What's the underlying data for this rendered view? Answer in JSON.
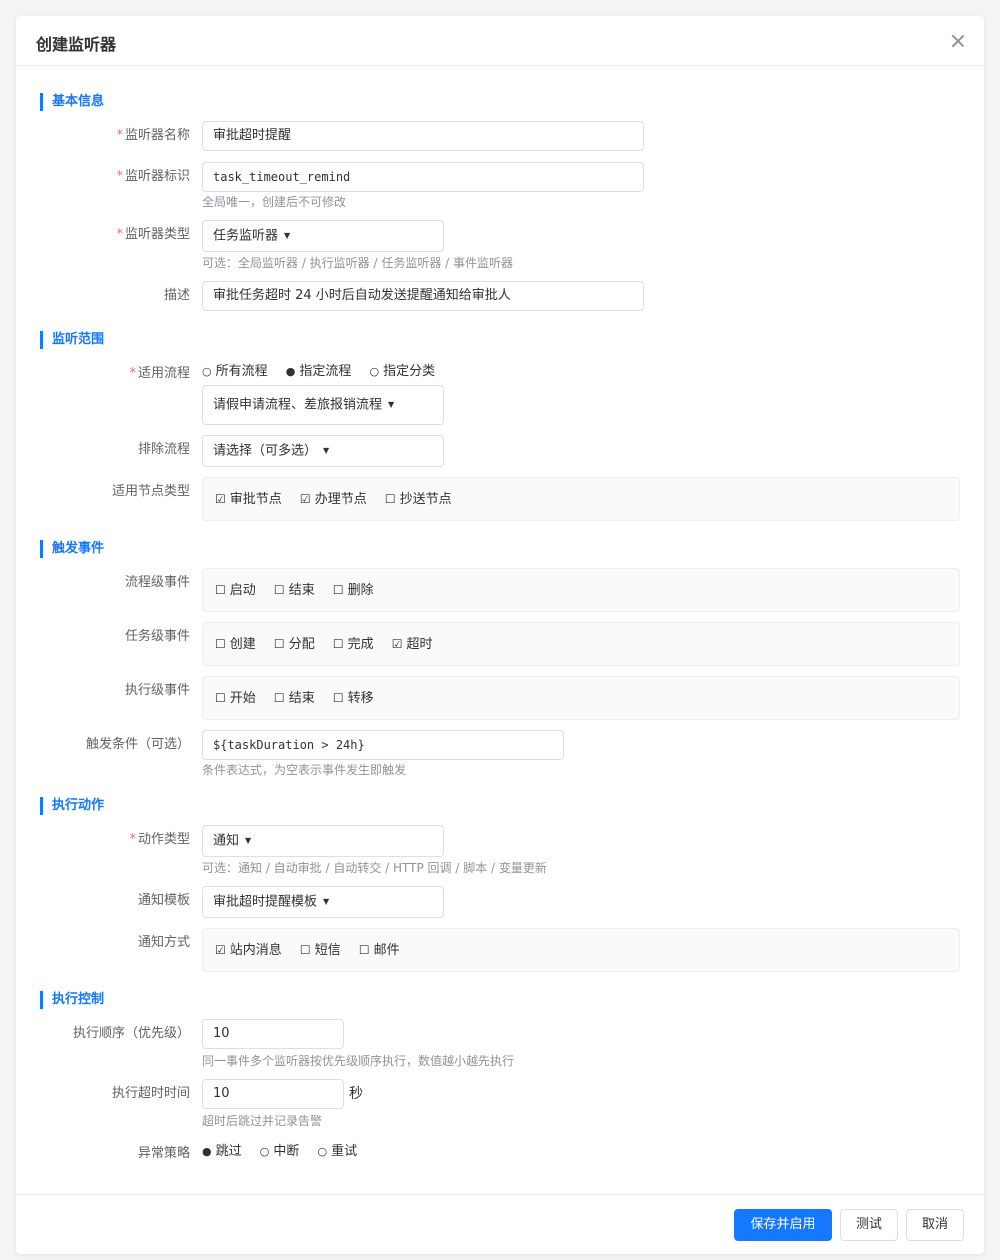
{
  "dialog": {
    "title": "创建监听器"
  },
  "sections": {
    "basic": "基本信息",
    "scope": "监听范围",
    "events": "触发事件",
    "actions": "执行动作",
    "control": "执行控制"
  },
  "required_mark": "*",
  "basic": {
    "name": {
      "label": "监听器名称",
      "value": "审批超时提醒"
    },
    "key": {
      "label": "监听器标识",
      "value": "task_timeout_remind",
      "hint": "全局唯一，创建后不可修改"
    },
    "type": {
      "label": "监听器类型",
      "value": "任务监听器",
      "hint": "可选：全局监听器 / 执行监听器 / 任务监听器 / 事件监听器"
    },
    "desc": {
      "label": "描述",
      "value": "审批任务超时 24 小时后自动发送提醒通知给审批人"
    }
  },
  "scope": {
    "process": {
      "label": "适用流程",
      "options": [
        {
          "label": "所有流程",
          "selected": false
        },
        {
          "label": "指定流程",
          "selected": true
        },
        {
          "label": "指定分类",
          "selected": false
        }
      ],
      "selected_value": "请假申请流程、差旅报销流程"
    },
    "exclude": {
      "label": "排除流程",
      "placeholder": "请选择（可多选）"
    },
    "node_types": {
      "label": "适用节点类型",
      "items": [
        {
          "label": "审批节点",
          "checked": true
        },
        {
          "label": "办理节点",
          "checked": true
        },
        {
          "label": "抄送节点",
          "checked": false
        }
      ]
    }
  },
  "events": {
    "process_level": {
      "label": "流程级事件",
      "items": [
        {
          "label": "启动",
          "checked": false
        },
        {
          "label": "结束",
          "checked": false
        },
        {
          "label": "删除",
          "checked": false
        }
      ]
    },
    "task_level": {
      "label": "任务级事件",
      "items": [
        {
          "label": "创建",
          "checked": false
        },
        {
          "label": "分配",
          "checked": false
        },
        {
          "label": "完成",
          "checked": false
        },
        {
          "label": "超时",
          "checked": true
        }
      ]
    },
    "execution_level": {
      "label": "执行级事件",
      "items": [
        {
          "label": "开始",
          "checked": false
        },
        {
          "label": "结束",
          "checked": false
        },
        {
          "label": "转移",
          "checked": false
        }
      ]
    },
    "condition": {
      "label": "触发条件（可选）",
      "value": "${taskDuration > 24h}",
      "hint": "条件表达式，为空表示事件发生即触发"
    }
  },
  "actions": {
    "type": {
      "label": "动作类型",
      "value": "通知",
      "hint": "可选：通知 / 自动审批 / 自动转交 / HTTP 回调 / 脚本 / 变量更新"
    },
    "template": {
      "label": "通知模板",
      "value": "审批超时提醒模板"
    },
    "channels": {
      "label": "通知方式",
      "items": [
        {
          "label": "站内消息",
          "checked": true
        },
        {
          "label": "短信",
          "checked": false
        },
        {
          "label": "邮件",
          "checked": false
        }
      ]
    }
  },
  "control": {
    "order": {
      "label": "执行顺序（优先级）",
      "value": "10",
      "hint": "同一事件多个监听器按优先级顺序执行，数值越小越先执行"
    },
    "timeout": {
      "label": "执行超时时间",
      "value": "10",
      "unit": "秒",
      "hint": "超时后跳过并记录告警"
    },
    "error_policy": {
      "label": "异常策略",
      "options": [
        {
          "label": "跳过",
          "selected": true
        },
        {
          "label": "中断",
          "selected": false
        },
        {
          "label": "重试",
          "selected": false
        }
      ]
    }
  },
  "footer": {
    "save_label": "保存并启用",
    "test_label": "测试",
    "cancel_label": "取消"
  },
  "icons": {
    "close": "close-icon",
    "dropdown": "chevron-down-icon"
  },
  "colors": {
    "accent": "#1677ff",
    "required": "#f56c6c"
  }
}
